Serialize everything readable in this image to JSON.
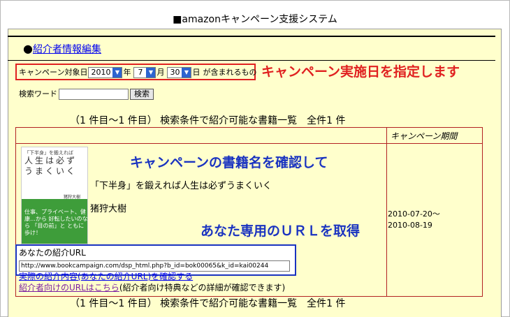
{
  "header": {
    "title": "■amazonキャンペーン支援システム"
  },
  "editor": {
    "bullet": "●",
    "link_label": "紹介者情報編集"
  },
  "date_filter": {
    "label": "キャンペーン対象日",
    "year": "2010",
    "year_suffix": "年",
    "month": "7",
    "month_suffix": "月",
    "day": "30",
    "day_suffix": "日",
    "tail": "が含まれるもの"
  },
  "annotations": {
    "date_note": "キャンペーン実施日を指定します",
    "book_note": "キャンペーンの書籍名を確認して",
    "url_note": "あなた専用のＵＲＬを取得"
  },
  "search": {
    "label": "検索ワード",
    "value": "",
    "button": "検索"
  },
  "results": {
    "summary": "（1 件目～1 件目） 検索条件で紹介可能な書籍一覧　全件1 件"
  },
  "table": {
    "period_header": "キャンペーン期間"
  },
  "book": {
    "title": "「下半身」を鍛えれば人生は必ずうまくいく",
    "author": "猪狩大樹",
    "period_start": "2010-07-20～",
    "period_end": "2010-08-19",
    "cover": {
      "top_text": "「下半身」を鍛えれば",
      "title_text": "人生は必ずうまくいく",
      "band_text": "仕事、プライベート、健康…から 好転したいのなら 「目の前」と ともに歩け！",
      "author_text": "猪狩大樹"
    }
  },
  "referral": {
    "label": "あなたの紹介URL",
    "url": "http://www.bookcampaign.com/dsp_html.php?b_id=bok00065&k_id=kai00244",
    "view_link": "実際の紹介内容(あなたの紹介URL)を確認する",
    "introducer_link": "紹介者向けのURLはこちら",
    "introducer_note": "(紹介者向け特典などの詳細が確認できます)"
  },
  "colors": {
    "panel": "#ffffcc",
    "red": "#e02020",
    "blue": "#1a33c0",
    "border": "#b22222"
  }
}
